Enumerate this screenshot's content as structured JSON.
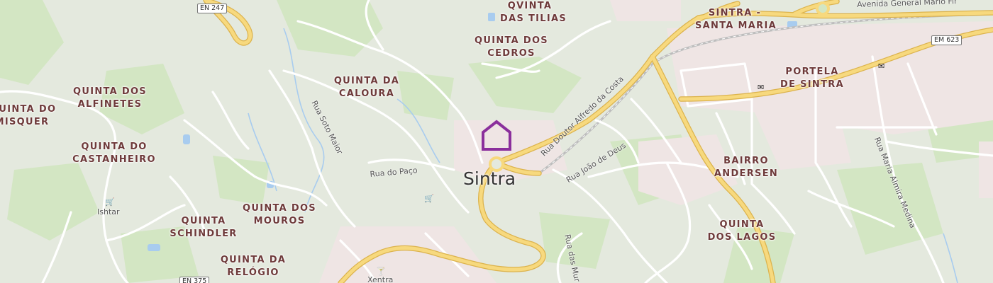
{
  "map": {
    "city_label": "Sintra",
    "areas": [
      {
        "name": "quinta-das-tilias",
        "lines": [
          "QVINTA",
          "DAS TILIAS"
        ]
      },
      {
        "name": "sintra-santa-maria",
        "lines": [
          "SINTRA -",
          "SANTA MARIA"
        ]
      },
      {
        "name": "quinta-dos-cedros",
        "lines": [
          "QUINTA DOS",
          "CEDROS"
        ]
      },
      {
        "name": "portela-de-sintra",
        "lines": [
          "PORTELA",
          "DE SINTRA"
        ]
      },
      {
        "name": "quinta-da-caloura",
        "lines": [
          "QUINTA DA",
          "CALOURA"
        ]
      },
      {
        "name": "quinta-dos-alfinetes",
        "lines": [
          "QUINTA DOS",
          "ALFINETES"
        ]
      },
      {
        "name": "quinta-do-misquer",
        "lines": [
          "QUINTA DO",
          "MISQUER"
        ]
      },
      {
        "name": "quinta-do-castanheiro",
        "lines": [
          "QUINTA DO",
          "CASTANHEIRO"
        ]
      },
      {
        "name": "bairro-andersen",
        "lines": [
          "BAIRRO",
          "ANDERSEN"
        ]
      },
      {
        "name": "quinta-schindler",
        "lines": [
          "QUINTA",
          "SCHINDLER"
        ]
      },
      {
        "name": "quinta-dos-mouros",
        "lines": [
          "QUINTA DOS",
          "MOUROS"
        ]
      },
      {
        "name": "quinta-dos-lagos",
        "lines": [
          "QUINTA",
          "DOS LAGOS"
        ]
      },
      {
        "name": "quinta-da-relogio",
        "lines": [
          "QUINTA DA",
          "RELÓGIO"
        ]
      }
    ],
    "streets": {
      "rua_doutor_alfredo_da_costa": "Rua Doutor Alfredo da Costa",
      "rua_joao_de_deus": "Rua João de Deus",
      "rua_soto_maior": "Rua Soto Maior",
      "rua_do_paco": "Rua do Paço",
      "rua_maria_almira_medina": "Rua Maria Almira Medina",
      "rua_das_murtas": "Rua das Mur",
      "avenida_general": "Avenida General Mario Firm"
    },
    "road_shields": {
      "en247": "EN 247",
      "em623": "EM 623",
      "en375": "EN 375"
    },
    "pois": {
      "ishtar": "Ishtar",
      "xentra": "Xentra"
    },
    "colors": {
      "background": "#e4e9de",
      "park": "#d3e6c3",
      "urban": "#efe5e4",
      "major_road": "#f7d97e",
      "major_road_casing": "#dcb34d",
      "minor_road": "#ffffff",
      "water": "#a8ccef",
      "area_label": "#6e3a3a",
      "marker": "#8b2f9c"
    },
    "icons": {
      "location_marker": "home-marker-icon",
      "basket": "basket-icon",
      "cocktail": "cocktail-icon",
      "mail": "mail-icon"
    }
  }
}
